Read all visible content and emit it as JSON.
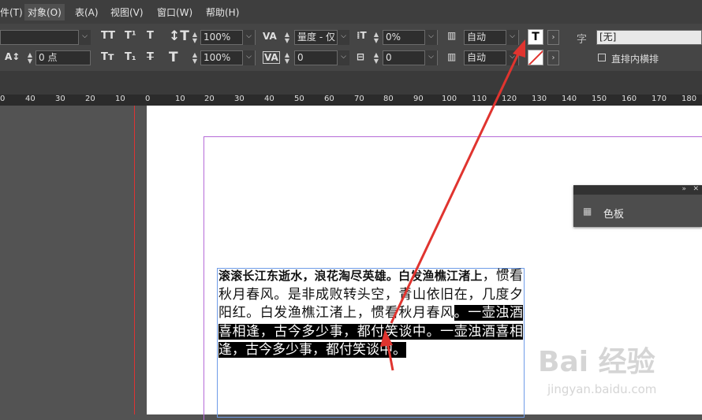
{
  "menu": {
    "items": [
      "件(T)",
      "对象(O)",
      "表(A)",
      "视图(V)",
      "窗口(W)",
      "帮助(H)"
    ]
  },
  "control": {
    "tracking_value": "100%",
    "scale_value": "100%",
    "kerning_value": "量度 - 仅",
    "baseline_value": "0 点",
    "tracking2_value": "0",
    "skew_value": "0%",
    "indent_value": "0",
    "auto1": "自动",
    "auto2": "自动",
    "char_style": "[无]",
    "char_label": "字",
    "vertical_in_horizontal": "直排内横排"
  },
  "ruler": {
    "left_ticks": [
      "0",
      "40",
      "30",
      "20",
      "10"
    ],
    "main_ticks": [
      "0",
      "10",
      "20",
      "30",
      "40",
      "50",
      "60",
      "70",
      "80",
      "90",
      "100",
      "110",
      "120",
      "130",
      "140",
      "150",
      "160",
      "170",
      "180"
    ]
  },
  "text_frame": {
    "bold_line": "滚滚长江东逝水，浪花淘尽英雄。白发渔樵江渚上",
    "line1_tail": "，惯",
    "normal": "看秋月春风。是非成败转头空，青山依旧在，几度夕阳红。白发渔樵江渚上，惯看秋月春风",
    "selected": "。一壶浊酒喜相逢，古今多少事，都付笑谈中。一壶浊酒喜相逢，古今多少事，都付笑谈中。"
  },
  "swatches_panel": {
    "title": "色板"
  },
  "watermark": {
    "text": "Bai 经验",
    "url": "jingyan.baidu.com"
  },
  "colors": {
    "arrow": "#e0342f",
    "selection": "#000000",
    "frame": "#6f9ce8"
  }
}
